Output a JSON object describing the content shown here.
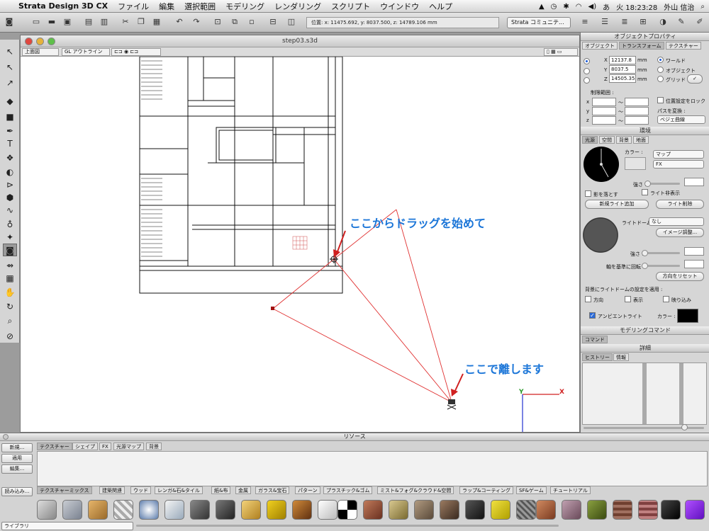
{
  "menubar": {
    "app_name": "Strata Design 3D CX",
    "items": [
      "ファイル",
      "編集",
      "選択範囲",
      "モデリング",
      "レンダリング",
      "スクリプト",
      "ウインドウ",
      "ヘルプ"
    ],
    "clock": "火 18:23:28",
    "user": "外山 信治"
  },
  "toolbar": {
    "position_readout": "位置: x: 11475.692, y: 8037.500, z: 14789.106 mm",
    "community_select": "Strata コミュニテ..."
  },
  "document": {
    "title": "step03.s3d",
    "view_select": "上面図",
    "render_select": "GL アウトライン"
  },
  "annotations": {
    "start_drag": "ここからドラッグを始めて",
    "release": "ここで離します"
  },
  "axis": {
    "x_label": "X",
    "y_label": "Y"
  },
  "object_properties": {
    "title": "オブジェクトプロパティ",
    "tabs": [
      "オブジェクト",
      "トランスフォーム",
      "テクスチャー"
    ],
    "x_value": "12137.8",
    "y_value": "8037.5",
    "z_value": "14505.35",
    "unit": "mm",
    "coord_x": "X",
    "coord_y": "Y",
    "coord_z": "Z",
    "radio_world": "ワールド",
    "radio_object": "オブジェクト",
    "radio_grid": "グリッド",
    "limits_label": "制限範囲 :",
    "limit_x": "x",
    "limit_y": "y",
    "limit_z": "z",
    "tilde": "〜",
    "lock_position": "位置設定をロック",
    "path_convert": "パスを変換 :",
    "path_select": "ベジェ曲線"
  },
  "environment": {
    "title": "環境",
    "tabs": [
      "光源",
      "空間",
      "背景",
      "地面"
    ],
    "color_label": "カラー :",
    "map_select": "マップ",
    "fx_select": "FX",
    "strength_label": "強さ :",
    "cast_shadow": "影を落とす",
    "hide_light": "ライト非表示",
    "add_light": "新規ライト追加",
    "delete_light": "ライト削除",
    "light_dome_label": "ライトドーム :",
    "light_dome_select": "なし",
    "image_adjust": "イメージ調整...",
    "strength2_label": "強さ :",
    "rotate_label": "軸を基準に回転 :",
    "reset_direction": "方向をリセット",
    "apply_bg_label": "背景にライトドームの設定を適用 :",
    "opt_direction": "方向",
    "opt_display": "表示",
    "opt_crop": "映り込み",
    "ambient_light": "アンビエントライト",
    "ambient_color_label": "カラー :"
  },
  "modeling_commands": {
    "title": "モデリングコマンド",
    "command_label": "コマンド"
  },
  "details": {
    "title": "詳細",
    "tabs": [
      "ヒストリー",
      "情報"
    ]
  },
  "resources": {
    "title": "リソース",
    "new_btn": "新規...",
    "apply_btn": "適用",
    "edit_btn": "編集...",
    "load_btn": "読み込み...",
    "library_select": "ライブラリ",
    "tabs": [
      "テクスチャー",
      "シェイプ",
      "FX",
      "光源マップ",
      "背景"
    ],
    "categories": [
      "テクスチャーミックス",
      "建築関連",
      "ウッド",
      "レンガ&石&タイル",
      "紙&布",
      "金属",
      "ガラス&宝石",
      "パターン",
      "プラスチック&ゴム",
      "ミスト&フォグ&クラウド&空間",
      "ラップ&コーティング",
      "SF&ゲーム",
      "チュートリアル"
    ]
  },
  "colors": {
    "accent_blue": "#1a75d8",
    "annotation_red": "#d02020",
    "light_line": "#e03030"
  }
}
